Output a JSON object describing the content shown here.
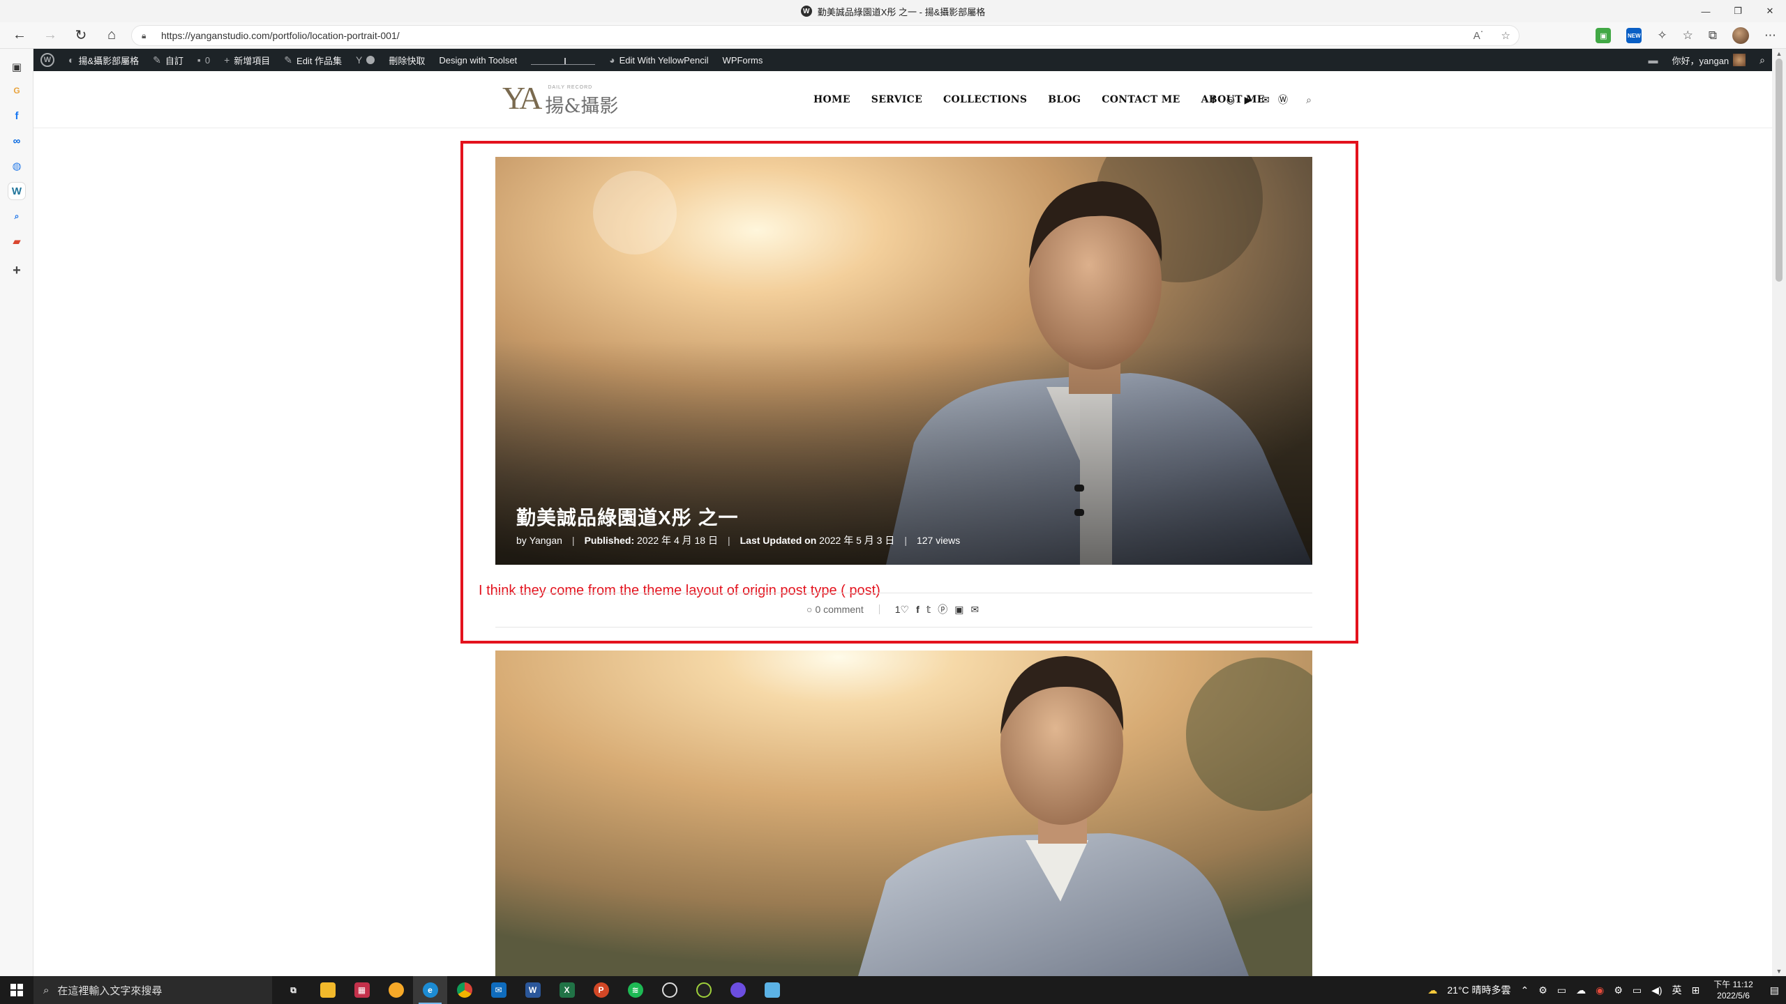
{
  "browser": {
    "tab_title": "勤美誠品綠園道X彤 之一 - 揚&攝影部屬格",
    "url": "https://yanganstudio.com/portfolio/location-portrait-001/"
  },
  "admin_bar": {
    "site_name": "揚&攝影部屬格",
    "customize": "自訂",
    "comments_count": "0",
    "new_item": "新增項目",
    "edit_item": "Edit 作品集",
    "clear_cache": "刪除快取",
    "toolset": "Design with Toolset",
    "yellowpencil": "Edit With YellowPencil",
    "wpforms": "WPForms",
    "greeting": "你好，yangan"
  },
  "site": {
    "logo_ya": "YA",
    "logo_small": "DAILY RECORD",
    "logo_cn": "揚&攝影",
    "menu": [
      "HOME",
      "SERVICE",
      "COLLECTIONS",
      "BLOG",
      "CONTACT ME",
      "ABOUT ME"
    ]
  },
  "post": {
    "title": "勤美誠品綠園道X彤 之一",
    "by_label": "by",
    "author": "Yangan",
    "published_label": "Published:",
    "published_date": "2022 年 4 月 18 日",
    "updated_label": "Last Updated on",
    "updated_date": "2022 年 5 月 3 日",
    "views": "127 views",
    "comments": "0 comment",
    "likes": "1"
  },
  "annotation": "I think they come from the theme layout of origin post type ( post)",
  "taskbar": {
    "search_placeholder": "在這裡輸入文字來搜尋",
    "weather": "21°C  晴時多雲",
    "ime": "英",
    "time": "下午 11:12",
    "date": "2022/5/6"
  },
  "colors": {
    "highlight": "#e3121d",
    "admin_bar": "#1d2327",
    "taskbar": "#1b1b1b"
  }
}
